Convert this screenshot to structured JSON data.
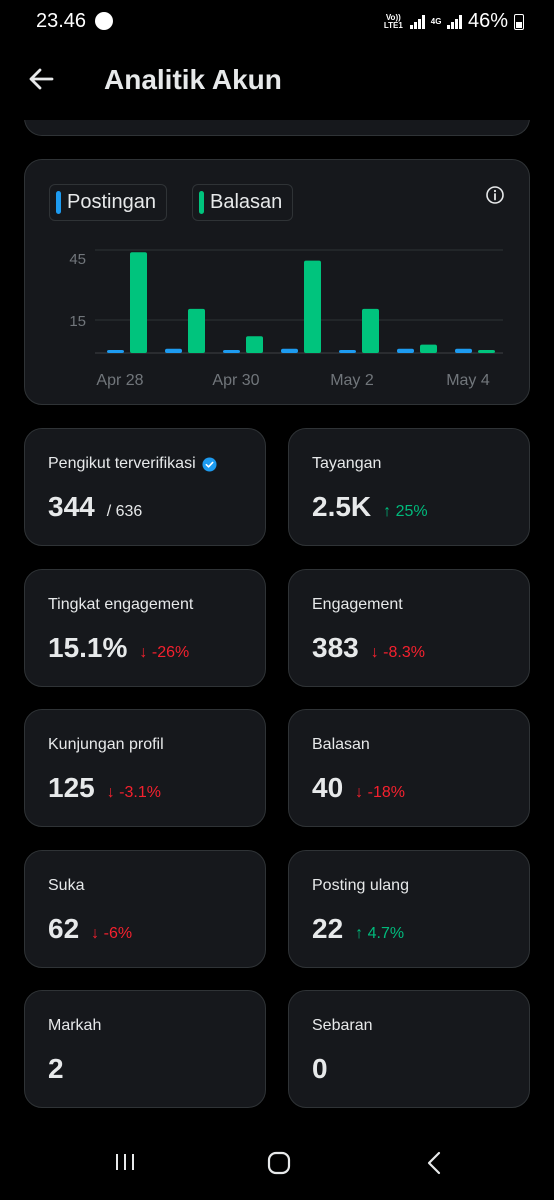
{
  "status_bar": {
    "time": "23.46",
    "network_volte": "Vo)) LTE1",
    "network_4g": "4G",
    "battery": "46%"
  },
  "header": {
    "title": "Analitik Akun"
  },
  "chart": {
    "legend": [
      "Postingan",
      "Balasan"
    ],
    "colors": {
      "Postingan": "#1d9bf0",
      "Balasan": "#00c47d"
    }
  },
  "chart_data": {
    "type": "bar",
    "categories": [
      "Apr 28",
      "Apr 29",
      "Apr 30",
      "May 1",
      "May 2",
      "May 3",
      "May 4"
    ],
    "x_tick_labels": [
      "Apr 28",
      "Apr 30",
      "May 2",
      "May 4"
    ],
    "y_tick_labels": [
      "45",
      "15"
    ],
    "series": [
      {
        "name": "Postingan",
        "values": [
          1,
          2,
          1,
          2,
          1,
          2,
          2
        ]
      },
      {
        "name": "Balasan",
        "values": [
          48,
          21,
          8,
          44,
          21,
          4,
          1
        ]
      }
    ],
    "ylim": [
      0,
      50
    ],
    "grid": true,
    "legend_position": "top-left"
  },
  "stats": [
    {
      "label": "Pengikut terverifikasi",
      "value": "344",
      "sub": "/ 636",
      "verified": true
    },
    {
      "label": "Tayangan",
      "value": "2.5K",
      "change": "25%",
      "direction": "up"
    },
    {
      "label": "Tingkat engagement",
      "value": "15.1%",
      "change": "-26%",
      "direction": "down"
    },
    {
      "label": "Engagement",
      "value": "383",
      "change": "-8.3%",
      "direction": "down"
    },
    {
      "label": "Kunjungan profil",
      "value": "125",
      "change": "-3.1%",
      "direction": "down"
    },
    {
      "label": "Balasan",
      "value": "40",
      "change": "-18%",
      "direction": "down"
    },
    {
      "label": "Suka",
      "value": "62",
      "change": "-6%",
      "direction": "down"
    },
    {
      "label": "Posting ulang",
      "value": "22",
      "change": "4.7%",
      "direction": "up"
    },
    {
      "label": "Markah",
      "value": "2"
    },
    {
      "label": "Sebaran",
      "value": "0"
    }
  ],
  "icons": {
    "back": "arrow-left-icon",
    "info": "info-icon",
    "verified": "verified-badge-icon",
    "up": "arrow-up-icon",
    "down": "arrow-down-icon"
  }
}
